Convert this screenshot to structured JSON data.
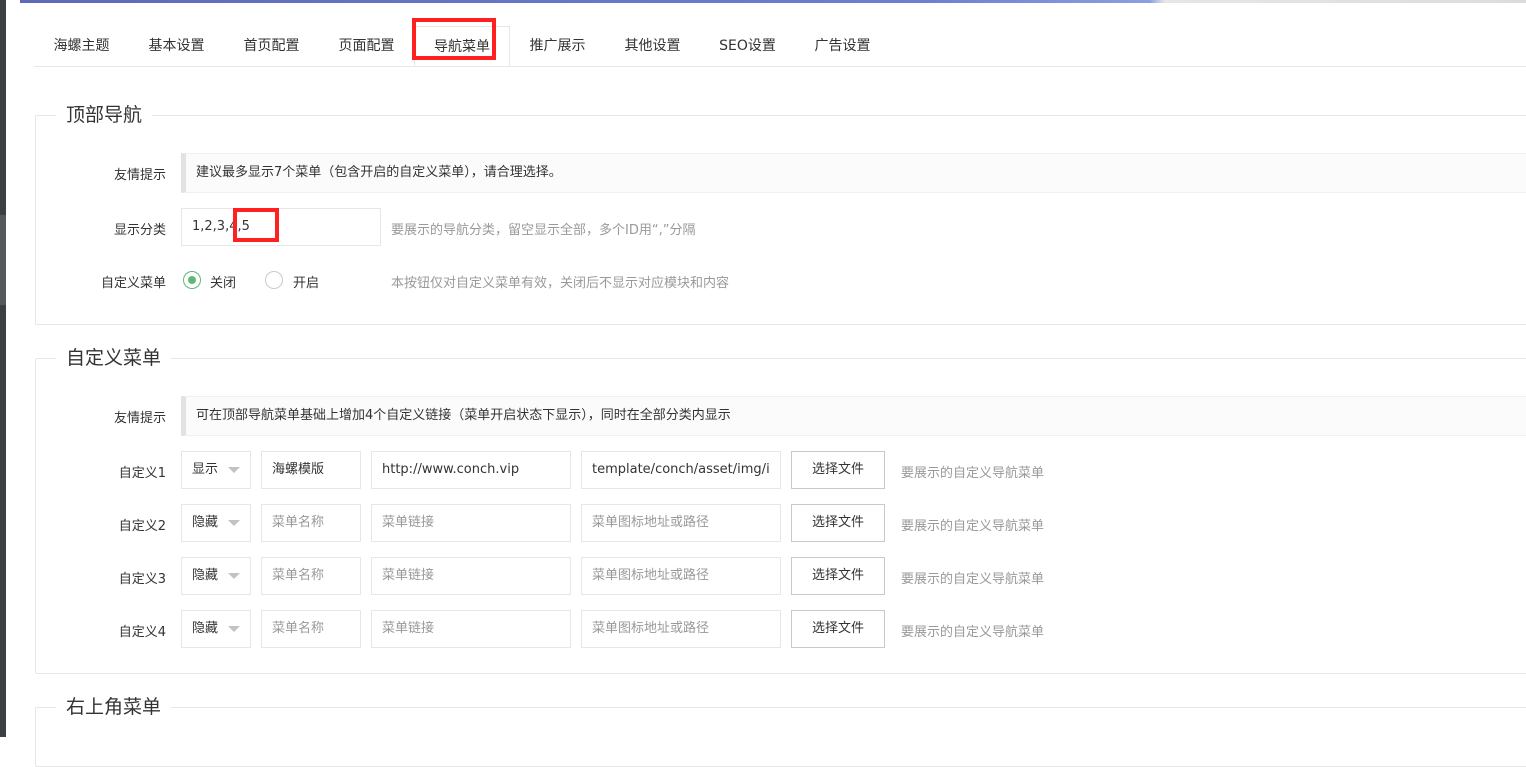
{
  "tabs": [
    {
      "label": "海螺主题"
    },
    {
      "label": "基本设置"
    },
    {
      "label": "首页配置"
    },
    {
      "label": "页面配置"
    },
    {
      "label": "导航菜单"
    },
    {
      "label": "推广展示"
    },
    {
      "label": "其他设置"
    },
    {
      "label": "SEO设置"
    },
    {
      "label": "广告设置"
    }
  ],
  "active_tab": "导航菜单",
  "top_nav": {
    "legend": "顶部导航",
    "tip_label": "友情提示",
    "tip_text": "建议最多显示7个菜单（包含开启的自定义菜单），请合理选择。",
    "category_label": "显示分类",
    "category_value": "1,2,3,4,5",
    "category_aux": "要展示的导航分类，留空显示全部，多个ID用“,”分隔",
    "custom_menu_label": "自定义菜单",
    "radio_off": "关闭",
    "radio_on": "开启",
    "radio_selected": "关闭",
    "custom_menu_aux": "本按钮仅对自定义菜单有效，关闭后不显示对应模块和内容"
  },
  "custom_menus": {
    "legend": "自定义菜单",
    "tip_label": "友情提示",
    "tip_text": "可在顶部导航菜单基础上增加4个自定义链接（菜单开启状态下显示），同时在全部分类内显示",
    "name_placeholder": "菜单名称",
    "link_placeholder": "菜单链接",
    "icon_placeholder": "菜单图标地址或路径",
    "button_label": "选择文件",
    "aux": "要展示的自定义导航菜单",
    "rows": [
      {
        "label": "自定义1",
        "visibility": "显示",
        "name": "海螺模版",
        "link": "http://www.conch.vip",
        "icon": "template/conch/asset/img/i"
      },
      {
        "label": "自定义2",
        "visibility": "隐藏",
        "name": "",
        "link": "",
        "icon": ""
      },
      {
        "label": "自定义3",
        "visibility": "隐藏",
        "name": "",
        "link": "",
        "icon": ""
      },
      {
        "label": "自定义4",
        "visibility": "隐藏",
        "name": "",
        "link": "",
        "icon": ""
      }
    ]
  },
  "top_right_menu": {
    "legend": "右上角菜单"
  },
  "colors": {
    "accent_green": "#5fb878",
    "highlight_red": "#ff2020",
    "border": "#e6e6e6"
  }
}
